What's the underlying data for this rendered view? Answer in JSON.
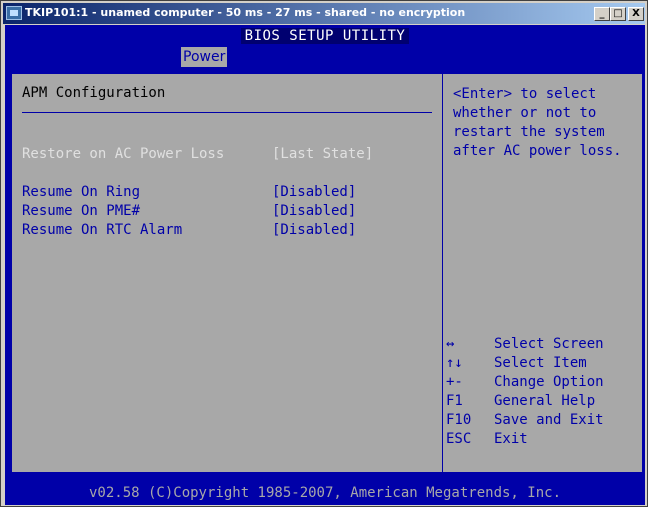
{
  "window": {
    "title": "TKIP101:1 - unamed computer - 50 ms - 27 ms - shared - no encryption",
    "buttons": {
      "minimize": "_",
      "maximize": "□",
      "close": "X"
    }
  },
  "bios": {
    "title": "BIOS SETUP UTILITY",
    "tabs": [
      {
        "label": "Power",
        "selected": true
      }
    ],
    "section_title": "APM Configuration",
    "settings": [
      {
        "label": "Restore on AC Power Loss",
        "value": "[Last State]",
        "selected": true
      },
      {
        "label": "Resume On Ring",
        "value": "[Disabled]"
      },
      {
        "label": "Resume On PME#",
        "value": "[Disabled]"
      },
      {
        "label": "Resume On RTC Alarm",
        "value": "[Disabled]"
      }
    ],
    "help_text": "<Enter> to select\nwhether or not to\nrestart the system\nafter AC power loss.",
    "keys": [
      {
        "key": "↔",
        "desc": "Select Screen"
      },
      {
        "key": "↑↓",
        "desc": "Select Item"
      },
      {
        "key": "+-",
        "desc": "Change Option"
      },
      {
        "key": "F1",
        "desc": "General Help"
      },
      {
        "key": "F10",
        "desc": "Save and Exit"
      },
      {
        "key": "ESC",
        "desc": "Exit"
      }
    ],
    "footer": "v02.58 (C)Copyright 1985-2007, American Megatrends, Inc."
  },
  "colors": {
    "bios_blue": "#0000a8",
    "panel_gray": "#a8a8a8",
    "selected_text": "#e0e0e0",
    "titlebar_start": "#0a246a",
    "titlebar_end": "#a6caf0"
  }
}
